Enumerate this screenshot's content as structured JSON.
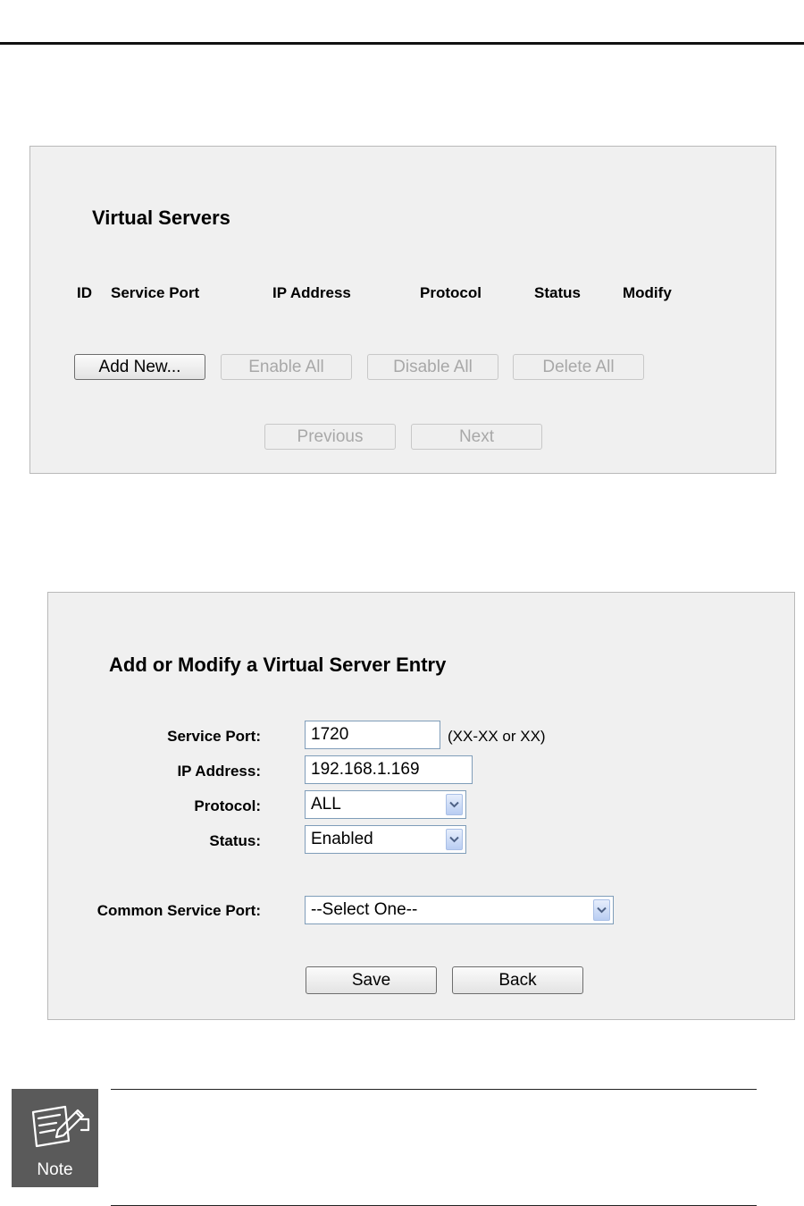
{
  "virtual_servers": {
    "title": "Virtual Servers",
    "columns": [
      "ID",
      "Service Port",
      "IP Address",
      "Protocol",
      "Status",
      "Modify"
    ],
    "buttons": {
      "add_new": "Add New...",
      "enable_all": "Enable All",
      "disable_all": "Disable All",
      "delete_all": "Delete All",
      "previous": "Previous",
      "next": "Next"
    }
  },
  "entry_form": {
    "title": "Add or Modify a Virtual Server Entry",
    "service_port": {
      "label": "Service Port:",
      "value": "1720",
      "hint": "(XX-XX or XX)"
    },
    "ip_address": {
      "label": "IP Address:",
      "value": "192.168.1.169"
    },
    "protocol": {
      "label": "Protocol:",
      "value": "ALL"
    },
    "status": {
      "label": "Status:",
      "value": "Enabled"
    },
    "common_service_port": {
      "label": "Common Service Port:",
      "value": "--Select One--"
    },
    "buttons": {
      "save": "Save",
      "back": "Back"
    }
  },
  "note": {
    "label": "Note",
    "icon": "note-icon"
  }
}
